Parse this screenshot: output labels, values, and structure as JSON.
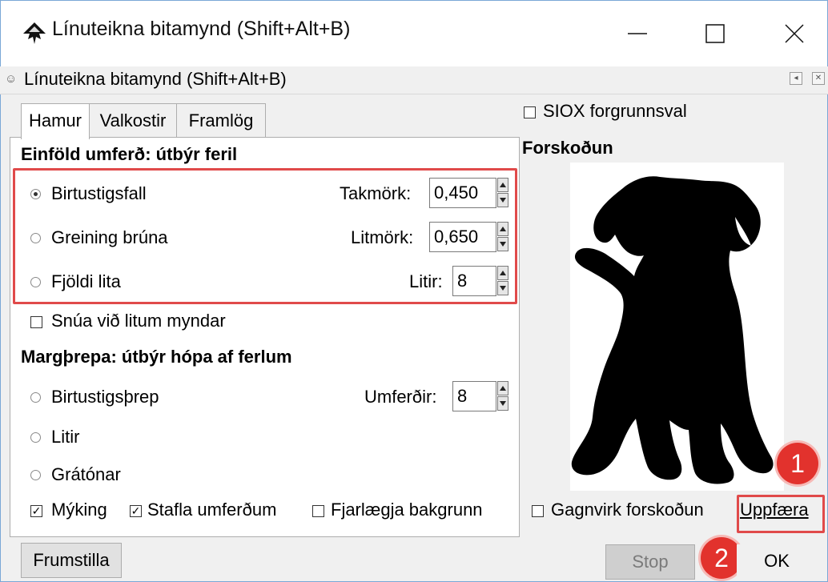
{
  "window": {
    "title": "Línuteikna bitamynd (Shift+Alt+B)",
    "dock_title": "Línuteikna bitamynd (Shift+Alt+B)"
  },
  "tabs": [
    {
      "label": "Hamur",
      "active": true
    },
    {
      "label": "Valkostir",
      "active": false
    },
    {
      "label": "Framlög",
      "active": false
    }
  ],
  "single_scan": {
    "title": "Einföld umferð: útbýr feril",
    "options": [
      {
        "label": "Birtustigsfall",
        "checked": true,
        "param_label": "Takmörk:",
        "param_value": "0,450"
      },
      {
        "label": "Greining brúna",
        "checked": false,
        "param_label": "Litmörk:",
        "param_value": "0,650"
      },
      {
        "label": "Fjöldi lita",
        "checked": false,
        "param_label": "Litir:",
        "param_value": "8"
      }
    ],
    "invert_label": "Snúa við litum myndar"
  },
  "multi_scan": {
    "title": "Margþrepa: útbýr hópa af ferlum",
    "options": [
      {
        "label": "Birtustigsþrep",
        "checked": false,
        "param_label": "Umferðir:",
        "param_value": "8"
      },
      {
        "label": "Litir",
        "checked": false
      },
      {
        "label": "Grátónar",
        "checked": false
      }
    ],
    "smooth_label": "Mýking",
    "stack_label": "Stafla umferðum",
    "remove_bg_label": "Fjarlægja bakgrunn"
  },
  "right": {
    "siox_label": "SIOX forgrunnsval",
    "preview_title": "Forskoðun",
    "live_preview_label": "Gagnvirk forskoðun",
    "update_label": "Uppfæra"
  },
  "buttons": {
    "reset": "Frumstilla",
    "stop": "Stop",
    "ok": "OK"
  },
  "badges": [
    "1",
    "2"
  ],
  "colors": {
    "highlight": "#e04a4a",
    "badge": "#e2322d",
    "title_border": "#7aa7d6"
  }
}
